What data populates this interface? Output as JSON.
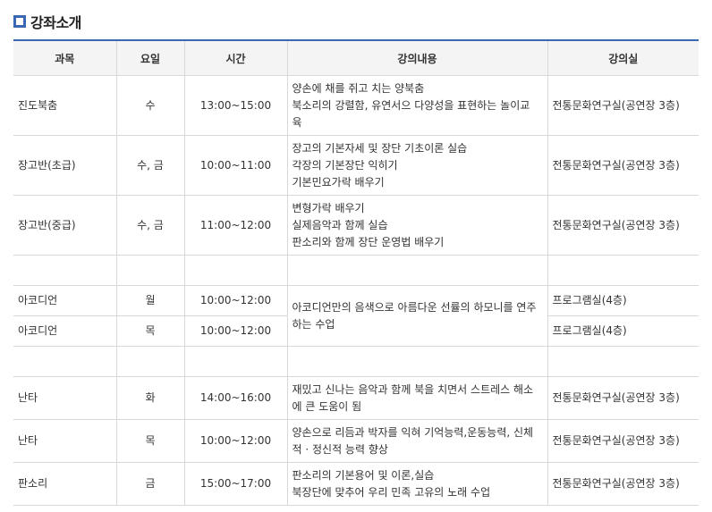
{
  "page_title": "강좌소개",
  "columns": [
    "과목",
    "요일",
    "시간",
    "강의내용",
    "강의실"
  ],
  "rows": [
    {
      "subject": "진도북춤",
      "day": "수",
      "time": "13:00~15:00",
      "content": [
        "양손에 채를 쥐고 치는 양북춤",
        "북소리의 강렬함, 유연서으 다양성을 표현하는 놀이교",
        "육"
      ],
      "room": "전통문화연구실(공연장 3층)"
    },
    {
      "subject": "장고반(초급)",
      "day": "수, 금",
      "time": "10:00~11:00",
      "content": [
        "장고의 기본자세 및 장단 기초이론 실습",
        "각장의 기본장단 익히기",
        "기본민요가락 배우기"
      ],
      "room": "전통문화연구실(공연장 3층)"
    },
    {
      "subject": "장고반(중급)",
      "day": "수, 금",
      "time": "11:00~12:00",
      "content": [
        "변형가락 배우기",
        "실제음악과 함께 실습",
        "판소리와 함께 장단 운영법 배우기"
      ],
      "room": "전통문화연구실(공연장 3층)"
    },
    {
      "subject": "아코디언",
      "day": "월",
      "time": "10:00~12:00",
      "content": [
        "아코디언만의 음색으로 아름다운 선률의 하모니를 연주",
        "하는 수업"
      ],
      "room": "프로그램실(4층)"
    },
    {
      "subject": "아코디언",
      "day": "목",
      "time": "10:00~12:00",
      "room": "프로그램실(4층)"
    },
    {
      "subject": "난타",
      "day": "화",
      "time": "14:00~16:00",
      "content": [
        "재밌고 신나는 음악과 함께 북을 치면서 스트레스 해소",
        "에 큰 도움이 됨"
      ],
      "room": "전통문화연구실(공연장 3층)"
    },
    {
      "subject": "난타",
      "day": "목",
      "time": "10:00~12:00",
      "content": [
        "양손으로 리듬과 박자를 익혀 기억능력,운동능력, 신체",
        "적 · 정신적 능력 향상"
      ],
      "room": "전통문화연구실(공연장 3층)"
    },
    {
      "subject": "판소리",
      "day": "금",
      "time": "15:00~17:00",
      "content": [
        "판소리의 기본용어 및 이론,실습",
        "북장단에 맞추어 우리 민족 고유의 노래 수업"
      ],
      "room": "전통문화연구실(공연장 3층)"
    }
  ]
}
